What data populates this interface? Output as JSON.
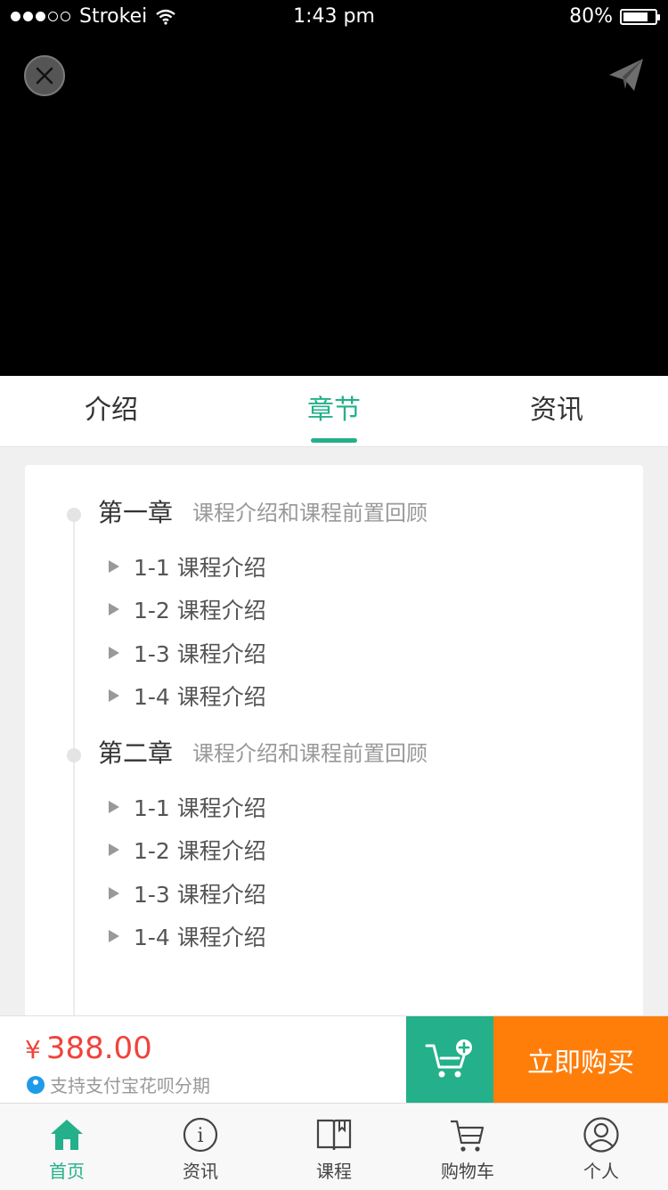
{
  "status_bar": {
    "carrier": "Strokei",
    "time": "1:43 pm",
    "battery": "80%",
    "battery_level": 0.8
  },
  "video": {
    "close_icon": "close-icon",
    "share_icon": "paper-plane-icon"
  },
  "tabs": [
    {
      "label": "介绍",
      "active": false
    },
    {
      "label": "章节",
      "active": true
    },
    {
      "label": "资讯",
      "active": false
    }
  ],
  "chapters": [
    {
      "title": "第一章",
      "desc": "课程介绍和课程前置回顾",
      "lessons": [
        "1-1 课程介绍",
        "1-2 课程介绍",
        "1-3 课程介绍",
        "1-4 课程介绍"
      ]
    },
    {
      "title": "第二章",
      "desc": "课程介绍和课程前置回顾",
      "lessons": [
        "1-1 课程介绍",
        "1-2 课程介绍",
        "1-3 课程介绍",
        "1-4 课程介绍"
      ]
    }
  ],
  "purchase": {
    "currency": "¥",
    "price": "388.00",
    "installment": "支持支付宝花呗分期",
    "buy_now": "立即购买",
    "add_cart_icon": "add-to-cart-icon"
  },
  "bottom_nav": [
    {
      "label": "首页",
      "icon": "home-icon",
      "active": true
    },
    {
      "label": "资讯",
      "icon": "info-icon",
      "active": false
    },
    {
      "label": "课程",
      "icon": "book-icon",
      "active": false
    },
    {
      "label": "购物车",
      "icon": "cart-icon",
      "active": false
    },
    {
      "label": "个人",
      "icon": "profile-icon",
      "active": false
    }
  ],
  "colors": {
    "accent": "#24b08a",
    "price": "#f0433a",
    "buy": "#ff7e0a"
  }
}
